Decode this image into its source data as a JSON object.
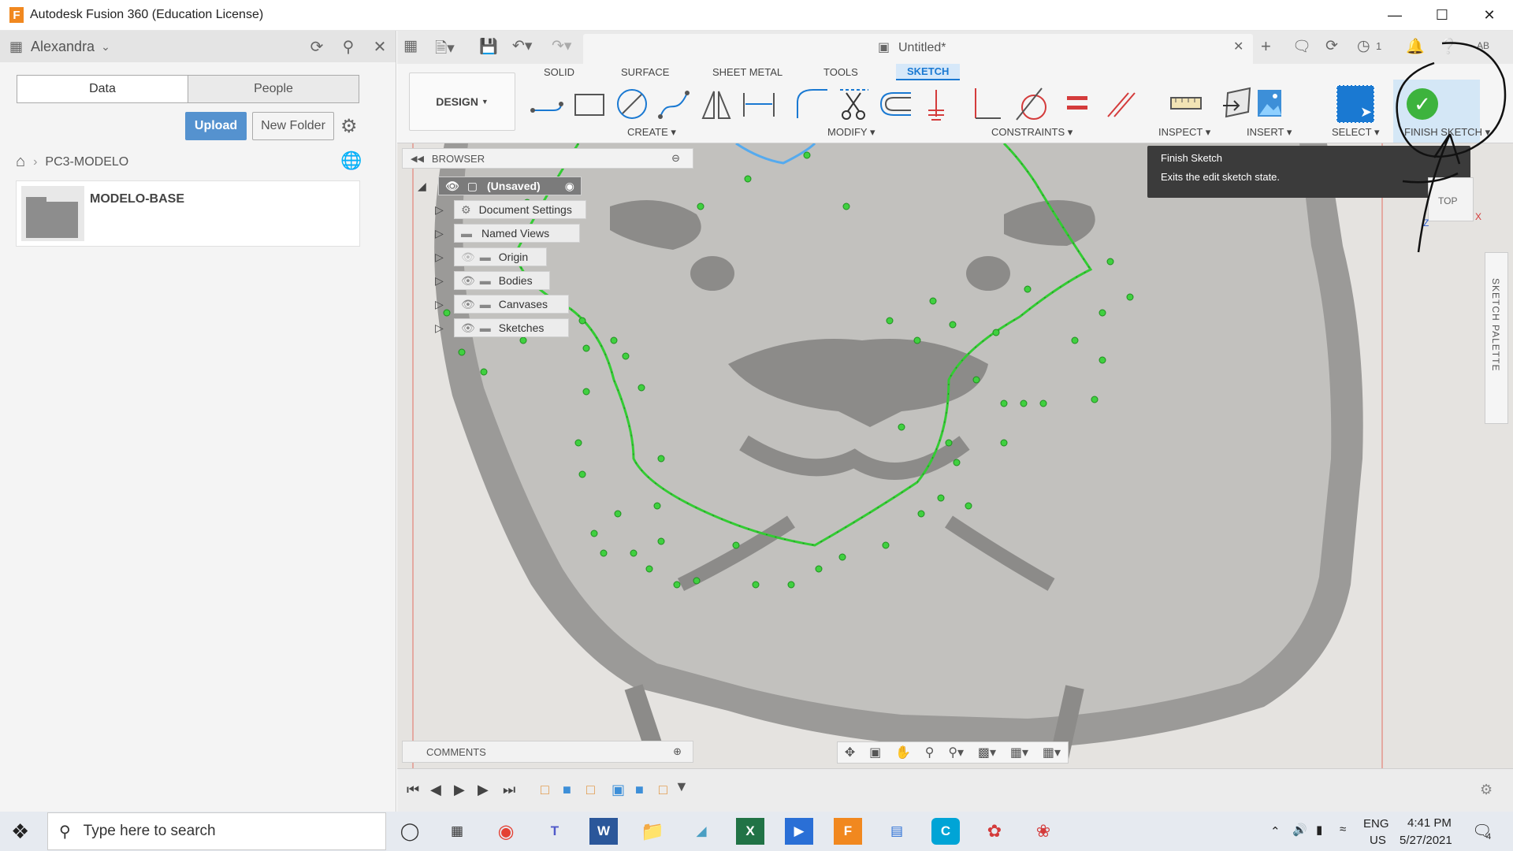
{
  "window": {
    "title": "Autodesk Fusion 360 (Education License)",
    "app_logo": "F",
    "controls": [
      "minimize-icon",
      "maximize-icon",
      "close-icon"
    ]
  },
  "data_panel": {
    "user_name": "Alexandra",
    "tabs": [
      {
        "label": "Data",
        "active": true
      },
      {
        "label": "People",
        "active": false
      }
    ],
    "upload_label": "Upload",
    "new_folder_label": "New Folder",
    "breadcrumb": {
      "project": "PC3-MODELO"
    },
    "items": [
      {
        "name": "MODELO-BASE",
        "type": "folder"
      }
    ]
  },
  "document": {
    "tab_title": "Untitled*",
    "job_count": "1",
    "user_initials": "AB"
  },
  "ribbon": {
    "workspace": "DESIGN",
    "tabs": [
      {
        "label": "SOLID",
        "selected": false
      },
      {
        "label": "SURFACE",
        "selected": false
      },
      {
        "label": "SHEET METAL",
        "selected": false
      },
      {
        "label": "TOOLS",
        "selected": false
      },
      {
        "label": "SKETCH",
        "selected": true
      }
    ],
    "groups": {
      "create": "CREATE",
      "modify": "MODIFY",
      "constraints": "CONSTRAINTS",
      "inspect": "INSPECT",
      "insert": "INSERT",
      "select": "SELECT",
      "finish": "FINISH SKETCH"
    }
  },
  "browser": {
    "title": "BROWSER",
    "root": "(Unsaved)",
    "nodes": [
      {
        "label": "Document Settings",
        "icon": "gear-icon"
      },
      {
        "label": "Named Views",
        "icon": "folder-icon"
      },
      {
        "label": "Origin",
        "icon": "folder-icon"
      },
      {
        "label": "Bodies",
        "icon": "folder-icon"
      },
      {
        "label": "Canvases",
        "icon": "folder-icon"
      },
      {
        "label": "Sketches",
        "icon": "folder-icon"
      }
    ]
  },
  "tooltip": {
    "title": "Finish Sketch",
    "description": "Exits the edit sketch state."
  },
  "viewcube": {
    "face": "TOP",
    "axis_x": "X",
    "axis_z": "Z"
  },
  "sketch_palette": {
    "label": "SKETCH PALETTE"
  },
  "comments": {
    "label": "COMMENTS"
  },
  "taskbar": {
    "search_placeholder": "Type here to search",
    "language": "ENG",
    "region": "US",
    "time": "4:41 PM",
    "date": "5/27/2021",
    "notification_count": "4"
  },
  "colors": {
    "accent": "#1a79d2",
    "sketch_green": "#33cc33",
    "finish_green": "#3db33d",
    "upload_blue": "#5592cf"
  }
}
